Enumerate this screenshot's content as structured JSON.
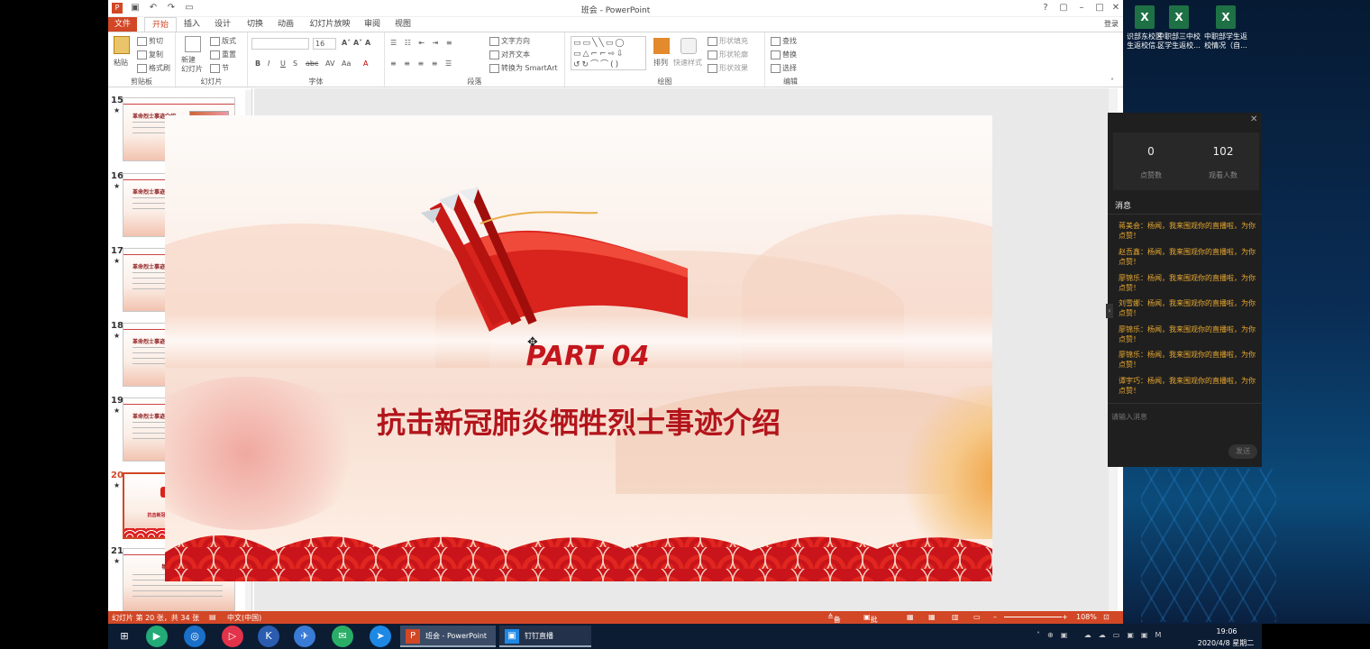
{
  "window": {
    "title": "班会 - PowerPoint",
    "login": "登录"
  },
  "tabs": [
    "文件",
    "开始",
    "插入",
    "设计",
    "切换",
    "动画",
    "幻灯片放映",
    "审阅",
    "视图"
  ],
  "ribbon": {
    "clipboard": {
      "label": "剪贴板",
      "paste": "粘贴",
      "cut": "剪切",
      "copy": "复制",
      "painter": "格式刷"
    },
    "slides": {
      "label": "幻灯片",
      "new": "新建\n幻灯片",
      "layout": "版式",
      "reset": "重置",
      "section": "节"
    },
    "font": {
      "label": "字体",
      "size": "16"
    },
    "paragraph": {
      "label": "段落",
      "direction": "文字方向",
      "align": "对齐文本",
      "smartart": "转换为 SmartArt"
    },
    "drawing": {
      "label": "绘图",
      "arrange": "排列",
      "quickstyle": "快速样式",
      "fill": "形状填充",
      "outline": "形状轮廓",
      "effect": "形状效果"
    },
    "editing": {
      "label": "编辑",
      "find": "查找",
      "replace": "替换",
      "select": "选择"
    }
  },
  "thumbnails": [
    {
      "num": "15",
      "title": "革命烈士事迹介绍"
    },
    {
      "num": "16",
      "title": "革命烈士事迹介绍"
    },
    {
      "num": "17",
      "title": "革命烈士事迹介绍"
    },
    {
      "num": "18",
      "title": "革命烈士事迹介绍"
    },
    {
      "num": "19",
      "title": "革命烈士事迹介绍"
    },
    {
      "num": "20",
      "title": "抗击新冠肺炎牺牲烈士事迹介绍",
      "part": "PART 04"
    },
    {
      "num": "21",
      "title": "牺牲烈士事迹"
    }
  ],
  "slide": {
    "part": "PART 04",
    "subtitle": "抗击新冠肺炎牺牲烈士事迹介绍"
  },
  "status": {
    "slide_info": "幻灯片 第 20 张，共 34 张",
    "lang": "中文(中国)",
    "notes": "备注",
    "comments": "批注",
    "zoom": "108%"
  },
  "desktop": {
    "icons": [
      "识部东校区\n生返校信...",
      "中职部三中校\n区学生返校...",
      "中职部学生返\n校情况（自..."
    ]
  },
  "live": {
    "likes": "0",
    "likes_label": "点赞数",
    "viewers": "102",
    "viewers_label": "观看人数",
    "section": "消息",
    "messages": [
      "蒋美会：杨闻，我来围观你的直播啦，为你点赞！",
      "赵吾鑫：杨闻，我来围观你的直播啦，为你点赞！",
      "廖锦乐：杨闻，我来围观你的直播啦，为你点赞！",
      "刘雪娜：杨闻，我来围观你的直播啦，为你点赞！",
      "廖锦乐：杨闻，我来围观你的直播啦，为你点赞！",
      "廖锦乐：杨闻，我来围观你的直播啦，为你点赞！",
      "谭宇巧：杨闻，我来围观你的直播啦，为你点赞！"
    ],
    "input_placeholder": "请输入消息",
    "send": "发送"
  },
  "taskbar": {
    "ppt": "班会 - PowerPoint",
    "live": "钉钉直播",
    "time": "19:06",
    "date": "2020/4/8 星期二"
  }
}
